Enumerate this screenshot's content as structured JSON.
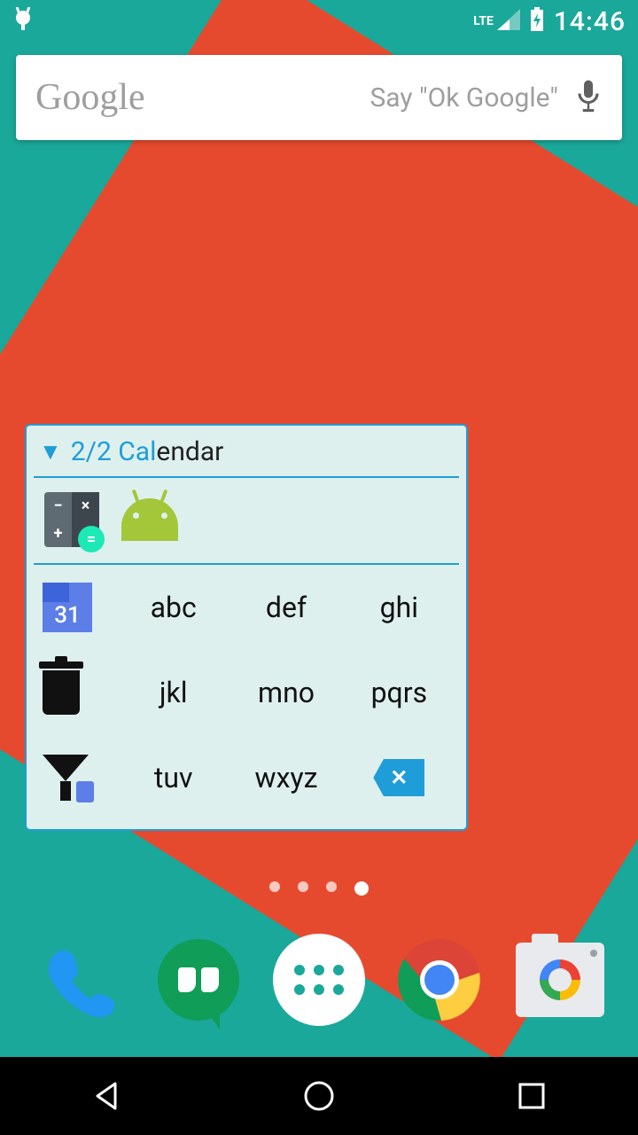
{
  "statusbar": {
    "lte": "LTE",
    "time": "14:46"
  },
  "search": {
    "logo": "Google",
    "hint": "Say \"Ok Google\""
  },
  "widget": {
    "header_prefix": "2/2 Cal",
    "header_suffix": "endar",
    "cal_day": "31",
    "keys": {
      "r1c2": "abc",
      "r1c3": "def",
      "r1c4": "ghi",
      "r2c2": "jkl",
      "r2c3": "mno",
      "r2c4": "pqrs",
      "r3c2": "tuv",
      "r3c3": "wxyz"
    },
    "backspace_glyph": "✕"
  },
  "pager": {
    "count": 4,
    "active": 4
  }
}
